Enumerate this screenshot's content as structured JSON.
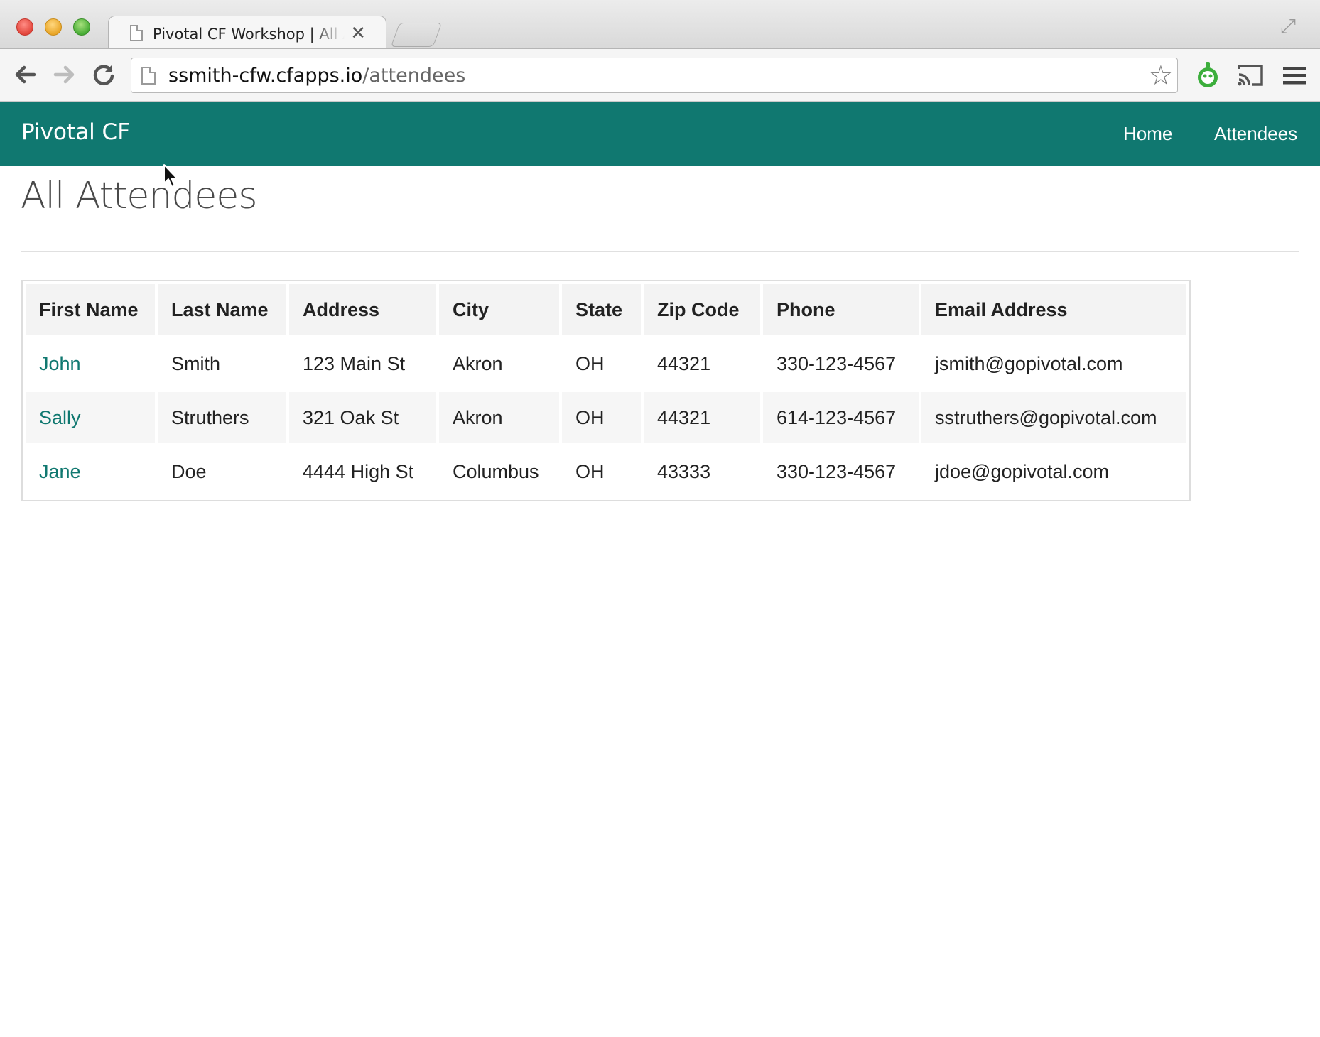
{
  "browser": {
    "tab_title": "Pivotal CF Workshop | All Attendees",
    "url_host": "ssmith-cfw.cfapps.io",
    "url_path": "/attendees"
  },
  "navbar": {
    "brand": "Pivotal CF",
    "links": [
      "Home",
      "Attendees"
    ],
    "color": "#107870"
  },
  "page": {
    "title": "All Attendees"
  },
  "table": {
    "headers": [
      "First Name",
      "Last Name",
      "Address",
      "City",
      "State",
      "Zip Code",
      "Phone",
      "Email Address"
    ],
    "rows": [
      [
        "John",
        "Smith",
        "123 Main St",
        "Akron",
        "OH",
        "44321",
        "330-123-4567",
        "jsmith@gopivotal.com"
      ],
      [
        "Sally",
        "Struthers",
        "321 Oak St",
        "Akron",
        "OH",
        "44321",
        "614-123-4567",
        "sstruthers@gopivotal.com"
      ],
      [
        "Jane",
        "Doe",
        "4444 High St",
        "Columbus",
        "OH",
        "43333",
        "330-123-4567",
        "jdoe@gopivotal.com"
      ]
    ]
  },
  "icons": {
    "toolbar": [
      "back-icon",
      "forward-icon",
      "reload-icon",
      "star-icon",
      "extension-icon",
      "cast-icon",
      "menu-icon"
    ]
  }
}
